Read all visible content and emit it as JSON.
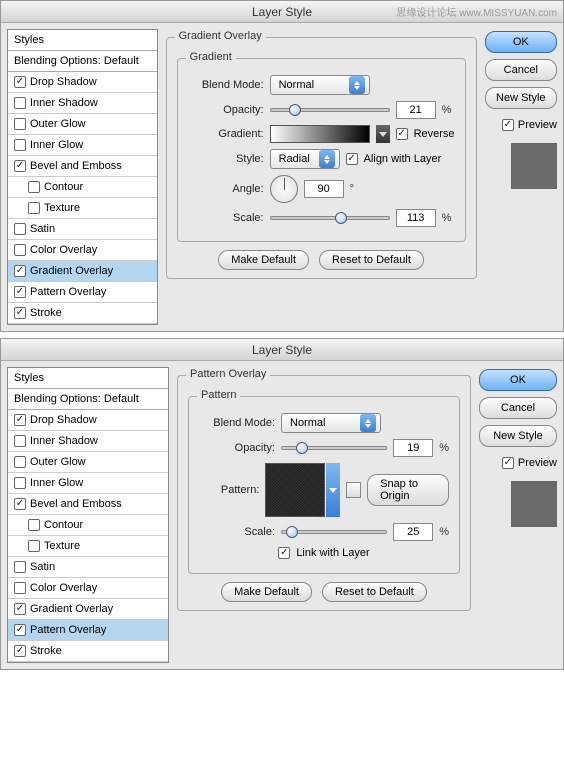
{
  "watermark": "思缘设计论坛 www.MISSYUAN.com",
  "dialogs": [
    {
      "title": "Layer Style",
      "styles_header": "Styles",
      "blending_options": "Blending Options: Default",
      "style_list": [
        {
          "label": "Drop Shadow",
          "checked": true,
          "indent": false,
          "selected": false
        },
        {
          "label": "Inner Shadow",
          "checked": false,
          "indent": false,
          "selected": false
        },
        {
          "label": "Outer Glow",
          "checked": false,
          "indent": false,
          "selected": false
        },
        {
          "label": "Inner Glow",
          "checked": false,
          "indent": false,
          "selected": false
        },
        {
          "label": "Bevel and Emboss",
          "checked": true,
          "indent": false,
          "selected": false
        },
        {
          "label": "Contour",
          "checked": false,
          "indent": true,
          "selected": false
        },
        {
          "label": "Texture",
          "checked": false,
          "indent": true,
          "selected": false
        },
        {
          "label": "Satin",
          "checked": false,
          "indent": false,
          "selected": false
        },
        {
          "label": "Color Overlay",
          "checked": false,
          "indent": false,
          "selected": false
        },
        {
          "label": "Gradient Overlay",
          "checked": true,
          "indent": false,
          "selected": true
        },
        {
          "label": "Pattern Overlay",
          "checked": true,
          "indent": false,
          "selected": false
        },
        {
          "label": "Stroke",
          "checked": true,
          "indent": false,
          "selected": false
        }
      ],
      "section_title": "Gradient Overlay",
      "inner_title": "Gradient",
      "labels": {
        "blend_mode": "Blend Mode:",
        "opacity": "Opacity:",
        "gradient": "Gradient:",
        "style": "Style:",
        "angle": "Angle:",
        "scale": "Scale:",
        "reverse": "Reverse",
        "align": "Align with Layer"
      },
      "values": {
        "blend_mode": "Normal",
        "opacity": "21",
        "opacity_pct": "%",
        "style": "Radial",
        "angle": "90",
        "angle_deg": "°",
        "scale": "113",
        "scale_pct": "%",
        "reverse_checked": true,
        "align_checked": true
      },
      "buttons": {
        "make_default": "Make Default",
        "reset": "Reset to Default"
      },
      "right": {
        "ok": "OK",
        "cancel": "Cancel",
        "new_style": "New Style",
        "preview": "Preview",
        "preview_checked": true
      }
    },
    {
      "title": "Layer Style",
      "styles_header": "Styles",
      "blending_options": "Blending Options: Default",
      "style_list": [
        {
          "label": "Drop Shadow",
          "checked": true,
          "indent": false,
          "selected": false
        },
        {
          "label": "Inner Shadow",
          "checked": false,
          "indent": false,
          "selected": false
        },
        {
          "label": "Outer Glow",
          "checked": false,
          "indent": false,
          "selected": false
        },
        {
          "label": "Inner Glow",
          "checked": false,
          "indent": false,
          "selected": false
        },
        {
          "label": "Bevel and Emboss",
          "checked": true,
          "indent": false,
          "selected": false
        },
        {
          "label": "Contour",
          "checked": false,
          "indent": true,
          "selected": false
        },
        {
          "label": "Texture",
          "checked": false,
          "indent": true,
          "selected": false
        },
        {
          "label": "Satin",
          "checked": false,
          "indent": false,
          "selected": false
        },
        {
          "label": "Color Overlay",
          "checked": false,
          "indent": false,
          "selected": false
        },
        {
          "label": "Gradient Overlay",
          "checked": true,
          "indent": false,
          "selected": false
        },
        {
          "label": "Pattern Overlay",
          "checked": true,
          "indent": false,
          "selected": true
        },
        {
          "label": "Stroke",
          "checked": true,
          "indent": false,
          "selected": false
        }
      ],
      "section_title": "Pattern Overlay",
      "inner_title": "Pattern",
      "labels": {
        "blend_mode": "Blend Mode:",
        "opacity": "Opacity:",
        "pattern": "Pattern:",
        "scale": "Scale:",
        "link": "Link with Layer",
        "snap": "Snap to Origin"
      },
      "values": {
        "blend_mode": "Normal",
        "opacity": "19",
        "opacity_pct": "%",
        "scale": "25",
        "scale_pct": "%",
        "link_checked": true
      },
      "buttons": {
        "make_default": "Make Default",
        "reset": "Reset to Default"
      },
      "right": {
        "ok": "OK",
        "cancel": "Cancel",
        "new_style": "New Style",
        "preview": "Preview",
        "preview_checked": true
      }
    }
  ]
}
